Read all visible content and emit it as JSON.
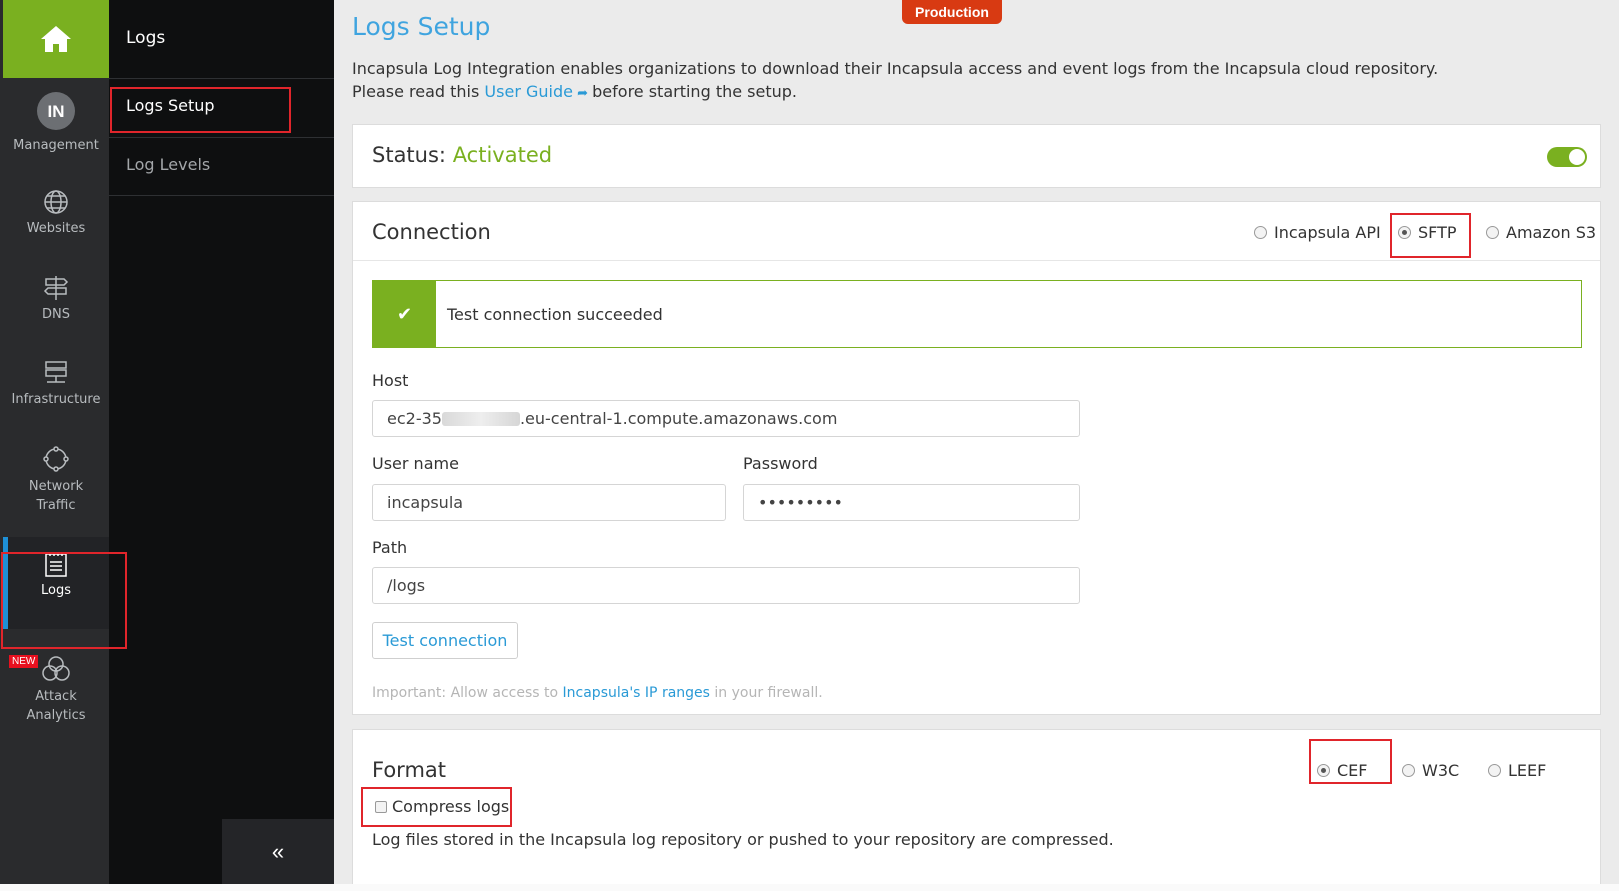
{
  "rail": {
    "items": [
      {
        "label": "Management",
        "avatar": "IN"
      },
      {
        "label": "Websites"
      },
      {
        "label": "DNS"
      },
      {
        "label": "Infrastructure"
      },
      {
        "label1": "Network",
        "label2": "Traffic"
      },
      {
        "label": "Logs"
      },
      {
        "label1": "Attack",
        "label2": "Analytics",
        "badge": "NEW"
      }
    ]
  },
  "submenu": {
    "title": "Logs",
    "items": [
      "Logs Setup",
      "Log Levels"
    ],
    "collapse_icon": "«"
  },
  "header": {
    "environment_badge": "Production",
    "title": "Logs Setup",
    "intro_line1": "Incapsula Log Integration enables organizations to download their Incapsula access and event logs from the Incapsula cloud repository.",
    "intro_line2_pre": "Please read this",
    "user_guide_link": "User Guide",
    "intro_line2_post": "before starting the setup."
  },
  "status": {
    "label": "Status:",
    "value": "Activated",
    "toggle_on": true
  },
  "connection": {
    "title": "Connection",
    "options": [
      "Incapsula API",
      "SFTP",
      "Amazon S3"
    ],
    "selected": "SFTP",
    "success_message": "Test connection succeeded",
    "host_label": "Host",
    "host_value_pre": "ec2-35",
    "host_value_post": ".eu-central-1.compute.amazonaws.com",
    "username_label": "User name",
    "username_value": "incapsula",
    "password_label": "Password",
    "password_value": "•••••••••",
    "path_label": "Path",
    "path_value": "/logs",
    "test_button": "Test connection",
    "note_pre": "Important: Allow access to",
    "note_link": "Incapsula's IP ranges",
    "note_post": "in your firewall."
  },
  "format": {
    "title": "Format",
    "options": [
      "CEF",
      "W3C",
      "LEEF"
    ],
    "selected": "CEF",
    "compress_label": "Compress logs",
    "compress_checked": false,
    "compress_description": "Log files stored in the Incapsula log repository or pushed to your repository are compressed."
  },
  "colors": {
    "accent_green": "#7ab020",
    "link_blue": "#2a9ad6",
    "badge_red": "#d83a12",
    "highlight_red": "#e0252b"
  }
}
